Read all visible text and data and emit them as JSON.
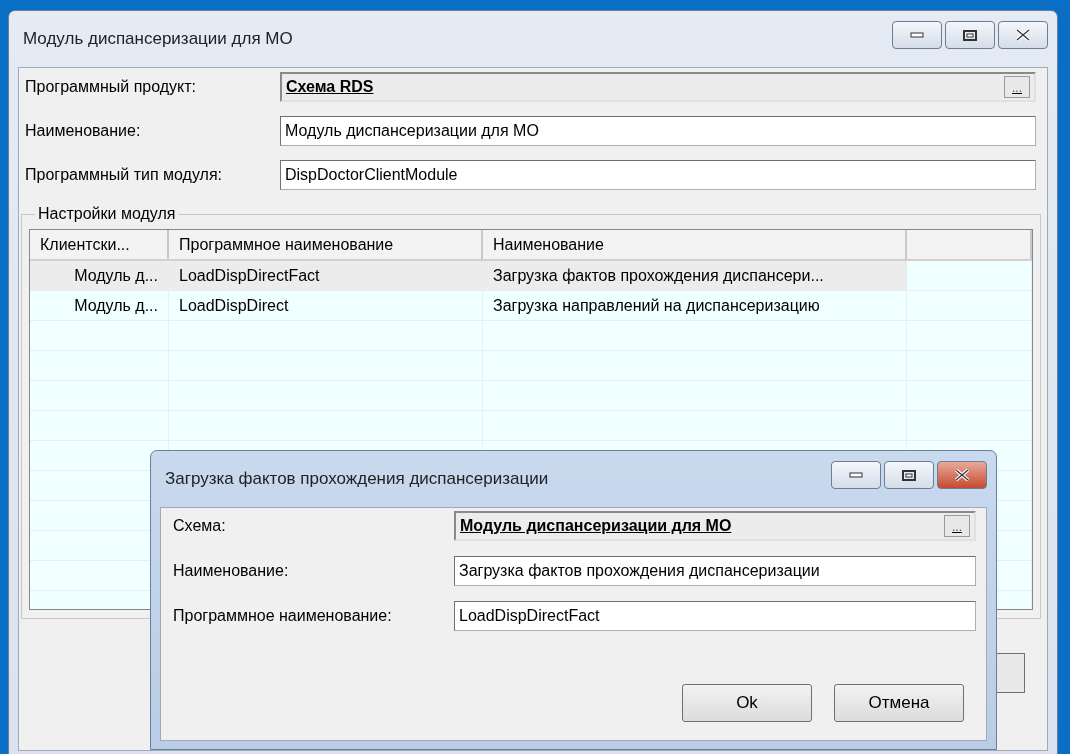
{
  "window": {
    "title": "Модуль диспансеризации для МО",
    "active": false
  },
  "fields": [
    {
      "kind": "lookup",
      "label": "Программный продукт:",
      "value": "Схема RDS",
      "button_text": "..."
    },
    {
      "kind": "text",
      "label": "Наименование:",
      "value": "Модуль диспансеризации для МО"
    },
    {
      "kind": "text",
      "label": "Программный тип модуля:",
      "value": "DispDoctorClientModule"
    }
  ],
  "settings": {
    "title": "Настройки модуля",
    "table": {
      "columns": [
        "Клиентски...",
        "Программное наименование",
        "Наименование"
      ],
      "rows": [
        {
          "cells": [
            "Модуль д...",
            "LoadDispDirectFact",
            "Загрузка фактов прохождения диспансери..."
          ],
          "selected": true
        },
        {
          "cells": [
            "Модуль д...",
            "LoadDispDirect",
            "Загрузка направлений на диспансеризацию"
          ],
          "selected": false
        }
      ]
    }
  },
  "dialog": {
    "title": "Загрузка фактов прохождения диспансеризации",
    "active": true,
    "fields": [
      {
        "kind": "lookup",
        "label": "Схема:",
        "value": "Модуль диспансеризации для МО",
        "button_text": "..."
      },
      {
        "kind": "text",
        "label": "Наименование:",
        "value": "Загрузка фактов прохождения диспансеризации"
      },
      {
        "kind": "text",
        "label": "Программное наименование:",
        "value": "LoadDispDirectFact"
      }
    ],
    "buttons": [
      "Ok",
      "Отмена"
    ]
  }
}
